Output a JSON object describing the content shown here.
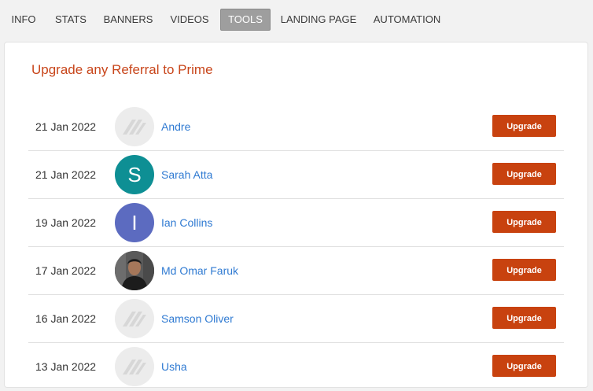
{
  "tabs": [
    "INFO",
    "STATS",
    "BANNERS",
    "VIDEOS",
    "TOOLS",
    "LANDING PAGE",
    "AUTOMATION"
  ],
  "active_tab": "TOOLS",
  "section_title": "Upgrade any Referral to Prime",
  "referrals": [
    {
      "date": "21 Jan 2022",
      "name": "Andre",
      "avatar": "placeholder-logo-icon"
    },
    {
      "date": "21 Jan 2022",
      "name": "Sarah Atta",
      "avatar": "initial",
      "initial": "S",
      "avatar_color": "#0e8f94"
    },
    {
      "date": "19 Jan 2022",
      "name": "Ian Collins",
      "avatar": "initial",
      "initial": "I",
      "avatar_color": "#5c6bc0"
    },
    {
      "date": "17 Jan 2022",
      "name": "Md Omar Faruk",
      "avatar": "photo"
    },
    {
      "date": "16 Jan 2022",
      "name": "Samson Oliver",
      "avatar": "placeholder-logo-icon"
    },
    {
      "date": "13 Jan 2022",
      "name": "Usha",
      "avatar": "placeholder-logo-icon"
    }
  ],
  "upgrade_label": "Upgrade",
  "colors": {
    "accent": "#c8420f",
    "link": "#2f7ad2",
    "active_tab_bg": "#9e9e9e"
  }
}
